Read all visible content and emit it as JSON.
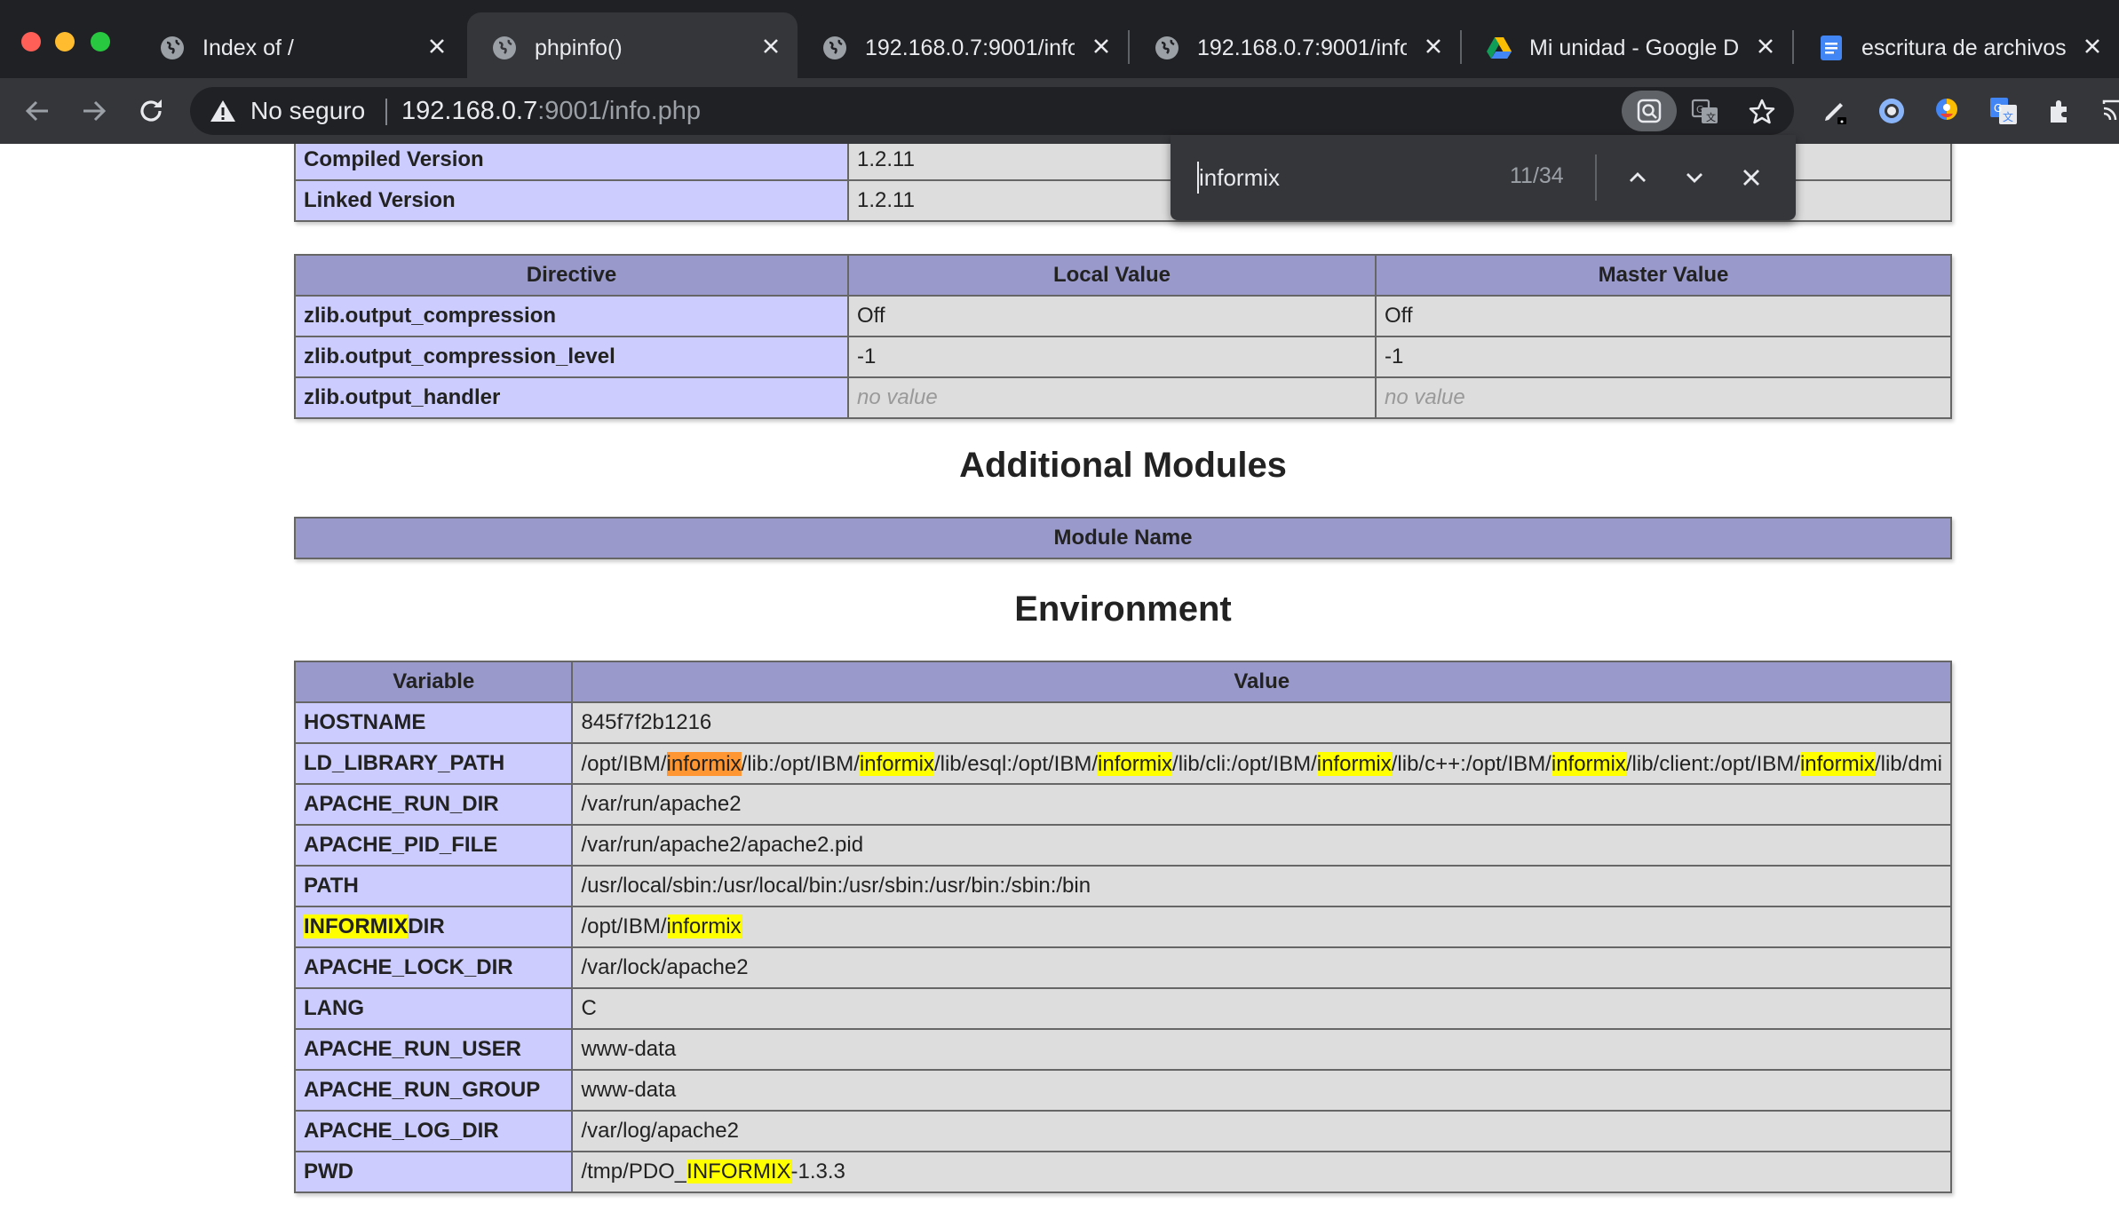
{
  "window": {
    "controls": {
      "close_color": "#ff5f57",
      "minimize_color": "#febc2e",
      "zoom_color": "#28c840"
    }
  },
  "tabs": [
    {
      "title": "Index of /",
      "icon": "globe-icon",
      "active": false
    },
    {
      "title": "phpinfo()",
      "icon": "globe-icon",
      "active": true
    },
    {
      "title": "192.168.0.7:9001/info",
      "icon": "globe-icon",
      "active": false
    },
    {
      "title": "192.168.0.7:9001/info",
      "icon": "globe-icon",
      "active": false
    },
    {
      "title": "Mi unidad - Google D",
      "icon": "google-drive-icon",
      "active": false
    },
    {
      "title": "escritura de archivos",
      "icon": "google-docs-icon",
      "active": false
    }
  ],
  "toolbar": {
    "security_label": "No seguro",
    "url_host": "192.168.0.7",
    "url_rest": ":9001/info.php"
  },
  "find_bar": {
    "query": "informix",
    "count": "11/34"
  },
  "page": {
    "top_table": {
      "rows": [
        {
          "label": "Compiled Version",
          "value": "1.2.11"
        },
        {
          "label": "Linked Version",
          "value": "1.2.11"
        }
      ]
    },
    "directive_table": {
      "headers": [
        "Directive",
        "Local Value",
        "Master Value"
      ],
      "rows": [
        {
          "name": "zlib.output_compression",
          "local": "Off",
          "master": "Off"
        },
        {
          "name": "zlib.output_compression_level",
          "local": "-1",
          "master": "-1"
        },
        {
          "name": "zlib.output_handler",
          "local": "no value",
          "master": "no value"
        }
      ]
    },
    "additional_modules": {
      "heading": "Additional Modules",
      "header": "Module Name"
    },
    "environment": {
      "heading": "Environment",
      "headers": [
        "Variable",
        "Value"
      ],
      "rows": [
        {
          "name": "HOSTNAME",
          "value": "845f7f2b1216"
        },
        {
          "name": "LD_LIBRARY_PATH",
          "value": "/opt/IBM/informix/lib:/opt/IBM/informix/lib/esql:/opt/IBM/informix/lib/cli:/opt/IBM/informix/lib/c++:/opt/IBM/informix/lib/client:/opt/IBM/informix/lib/dmi"
        },
        {
          "name": "APACHE_RUN_DIR",
          "value": "/var/run/apache2"
        },
        {
          "name": "APACHE_PID_FILE",
          "value": "/var/run/apache2/apache2.pid"
        },
        {
          "name": "PATH",
          "value": "/usr/local/sbin:/usr/local/bin:/usr/sbin:/usr/bin:/sbin:/bin"
        },
        {
          "name": "INFORMIXDIR",
          "value": "/opt/IBM/informix"
        },
        {
          "name": "APACHE_LOCK_DIR",
          "value": "/var/lock/apache2"
        },
        {
          "name": "LANG",
          "value": "C"
        },
        {
          "name": "APACHE_RUN_USER",
          "value": "www-data"
        },
        {
          "name": "APACHE_RUN_GROUP",
          "value": "www-data"
        },
        {
          "name": "APACHE_LOG_DIR",
          "value": "/var/log/apache2"
        },
        {
          "name": "PWD",
          "value": "/tmp/PDO_INFORMIX-1.3.3"
        }
      ]
    }
  },
  "colors": {
    "php_header": "#9999cc",
    "php_label": "#ccccff",
    "php_value": "#dddddd",
    "match_highlight": "#ffff00",
    "active_match_highlight": "#ff9632"
  }
}
